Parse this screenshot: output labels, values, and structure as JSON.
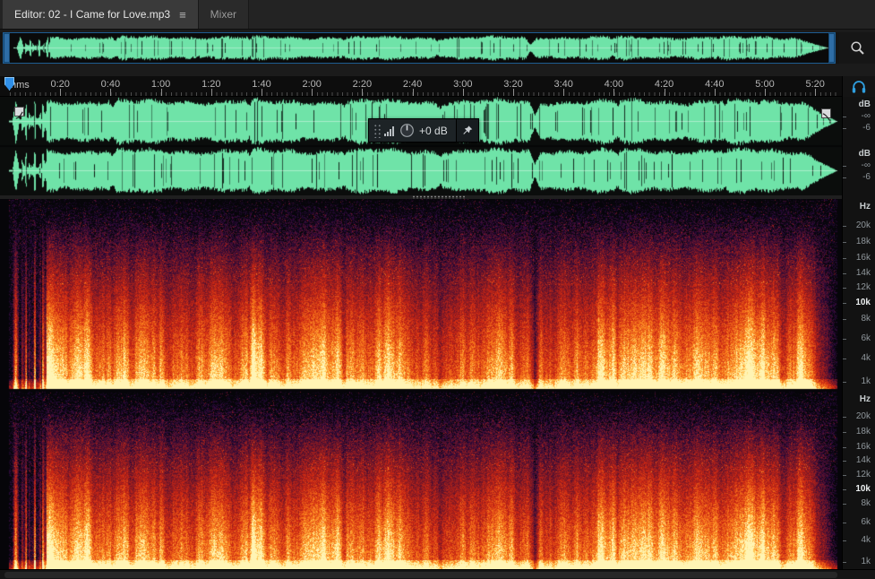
{
  "tabs": {
    "editor_label": "Editor: 02 - I Came for Love.mp3",
    "editor_menu_icon": "≡",
    "mixer_label": "Mixer"
  },
  "timeline": {
    "unit_label": "hms",
    "ticks": [
      "0:20",
      "0:40",
      "1:00",
      "1:20",
      "1:40",
      "2:00",
      "2:20",
      "2:40",
      "3:00",
      "3:20",
      "3:40",
      "4:00",
      "4:20",
      "4:40",
      "5:00",
      "5:20"
    ]
  },
  "hud": {
    "gain_value": "+0 dB"
  },
  "waveform": {
    "channels": 2,
    "scale_title": "dB",
    "scale_labels": [
      "-∞",
      "-6"
    ]
  },
  "spectral": {
    "channels": 2,
    "scale_title": "Hz",
    "scale_labels": [
      "20k",
      "18k",
      "16k",
      "14k",
      "12k",
      "10k",
      "8k",
      "6k",
      "4k",
      "1k"
    ],
    "highlight_label": "10k"
  },
  "icons": {
    "panel_menu": "panel-menu-icon",
    "zoom": "magnifier-icon",
    "monitor": "headphones-icon",
    "pin": "pin-icon",
    "gain_knob": "knob-icon",
    "level_meter": "level-bars-icon",
    "fade_in": "fade-in-handle",
    "fade_out": "fade-out-handle"
  },
  "colors": {
    "accent_blue": "#2f8fe8",
    "waveform_green": "#6fe3a8",
    "navigator_handle": "#2e6da6",
    "spectro_yellow": "#ffd05c",
    "spectro_orange": "#fc821c",
    "spectro_red": "#cd2612",
    "spectro_purple": "#26083a",
    "tab_active_bg": "#3a3a3a",
    "panel_bg": "#1b1b1b"
  }
}
